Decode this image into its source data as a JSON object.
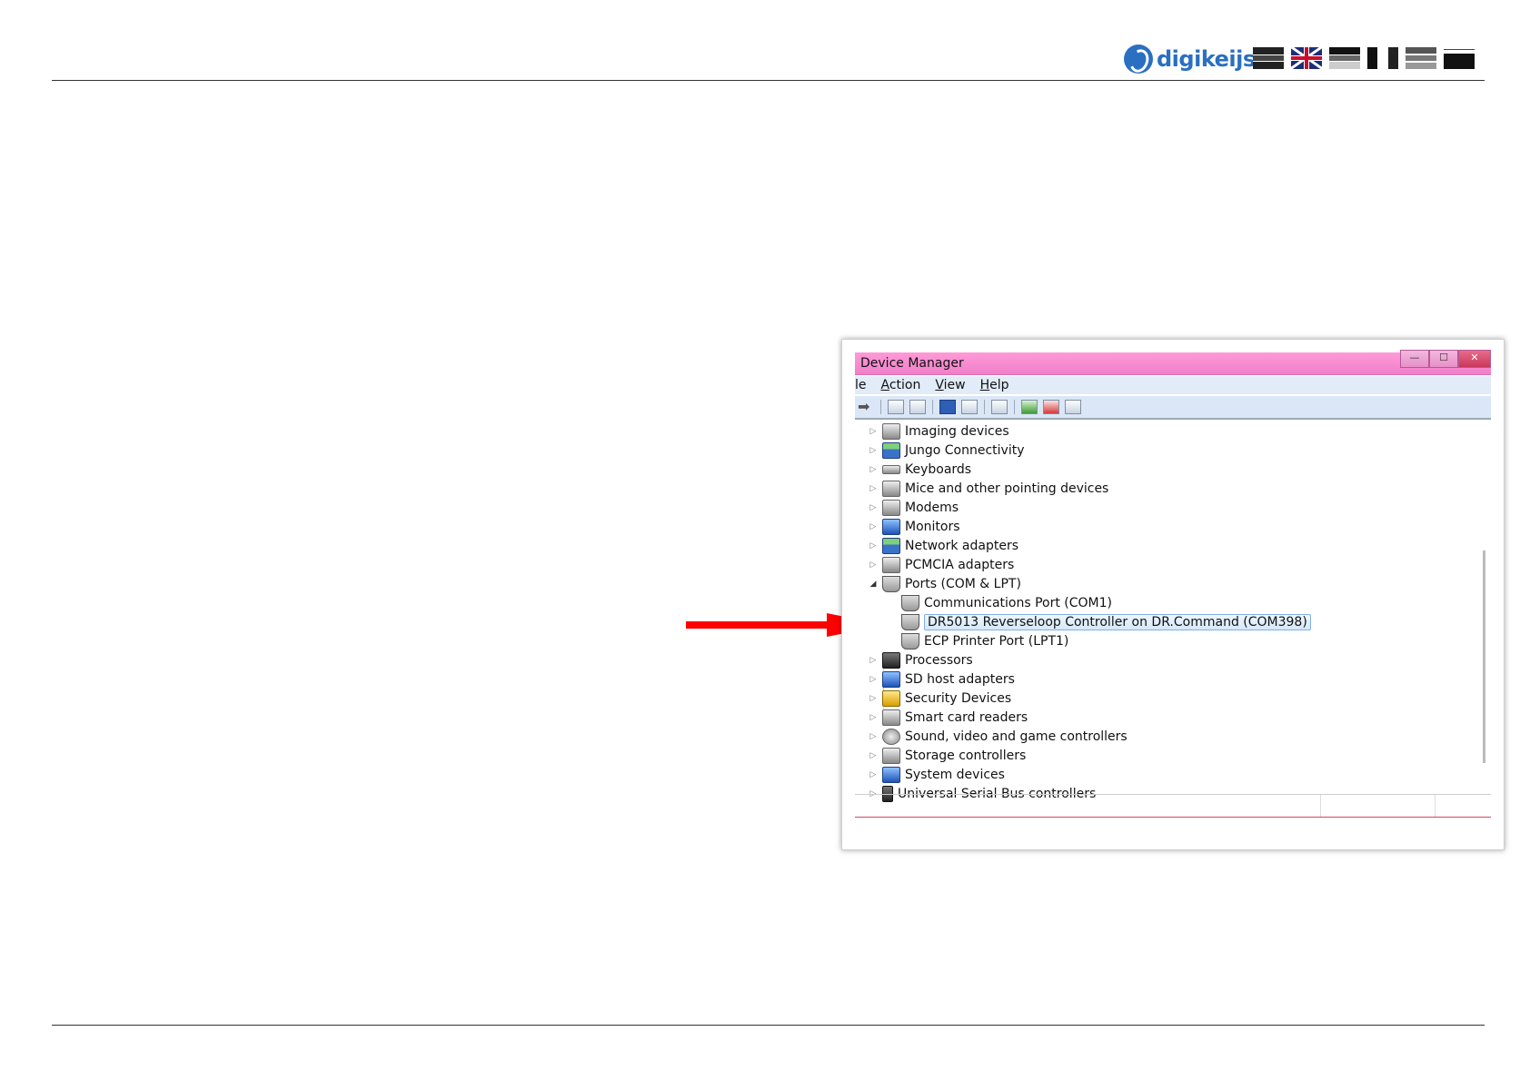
{
  "header": {
    "logo_text": "digikeijs",
    "logo_reg": "®"
  },
  "window": {
    "title": "Device Manager",
    "buttons": {
      "minimize": "—",
      "maximize": "☐",
      "close": "✕"
    },
    "menu": [
      {
        "label": "le",
        "underline": ""
      },
      {
        "label": "ction",
        "underline": "A"
      },
      {
        "label": "iew",
        "underline": "V"
      },
      {
        "label": "elp",
        "underline": "H"
      }
    ],
    "tree": [
      {
        "label": "Imaging devices",
        "icon": "camera-icon",
        "expanded": false
      },
      {
        "label": "Jungo Connectivity",
        "icon": "network-icon",
        "expanded": false
      },
      {
        "label": "Keyboards",
        "icon": "keyboard-icon",
        "expanded": false
      },
      {
        "label": "Mice and other pointing devices",
        "icon": "mouse-icon",
        "expanded": false
      },
      {
        "label": "Modems",
        "icon": "modem-icon",
        "expanded": false
      },
      {
        "label": "Monitors",
        "icon": "monitor-icon",
        "expanded": false
      },
      {
        "label": "Network adapters",
        "icon": "network-icon",
        "expanded": false
      },
      {
        "label": "PCMCIA adapters",
        "icon": "pcmcia-icon",
        "expanded": false
      },
      {
        "label": "Ports (COM & LPT)",
        "icon": "port-icon",
        "expanded": true
      },
      {
        "label": "Communications Port (COM1)",
        "icon": "port-icon",
        "child": true
      },
      {
        "label": "DR5013 Reverseloop Controller on DR.Command (COM398)",
        "icon": "port-icon",
        "child": true,
        "selected": true
      },
      {
        "label": "ECP Printer Port (LPT1)",
        "icon": "port-icon",
        "child": true
      },
      {
        "label": "Processors",
        "icon": "processor-icon",
        "expanded": false
      },
      {
        "label": "SD host adapters",
        "icon": "sd-card-icon",
        "expanded": false
      },
      {
        "label": "Security Devices",
        "icon": "key-icon",
        "expanded": false
      },
      {
        "label": "Smart card readers",
        "icon": "smart-card-icon",
        "expanded": false
      },
      {
        "label": "Sound, video and game controllers",
        "icon": "speaker-icon",
        "expanded": false
      },
      {
        "label": "Storage controllers",
        "icon": "storage-icon",
        "expanded": false
      },
      {
        "label": "System devices",
        "icon": "system-icon",
        "expanded": false
      },
      {
        "label": "Universal Serial Bus controllers",
        "icon": "usb-icon",
        "expanded": false
      }
    ]
  },
  "colors": {
    "titlebar": "#f07fc9",
    "arrow": "#ff0000",
    "brand": "#2a6fc1"
  }
}
